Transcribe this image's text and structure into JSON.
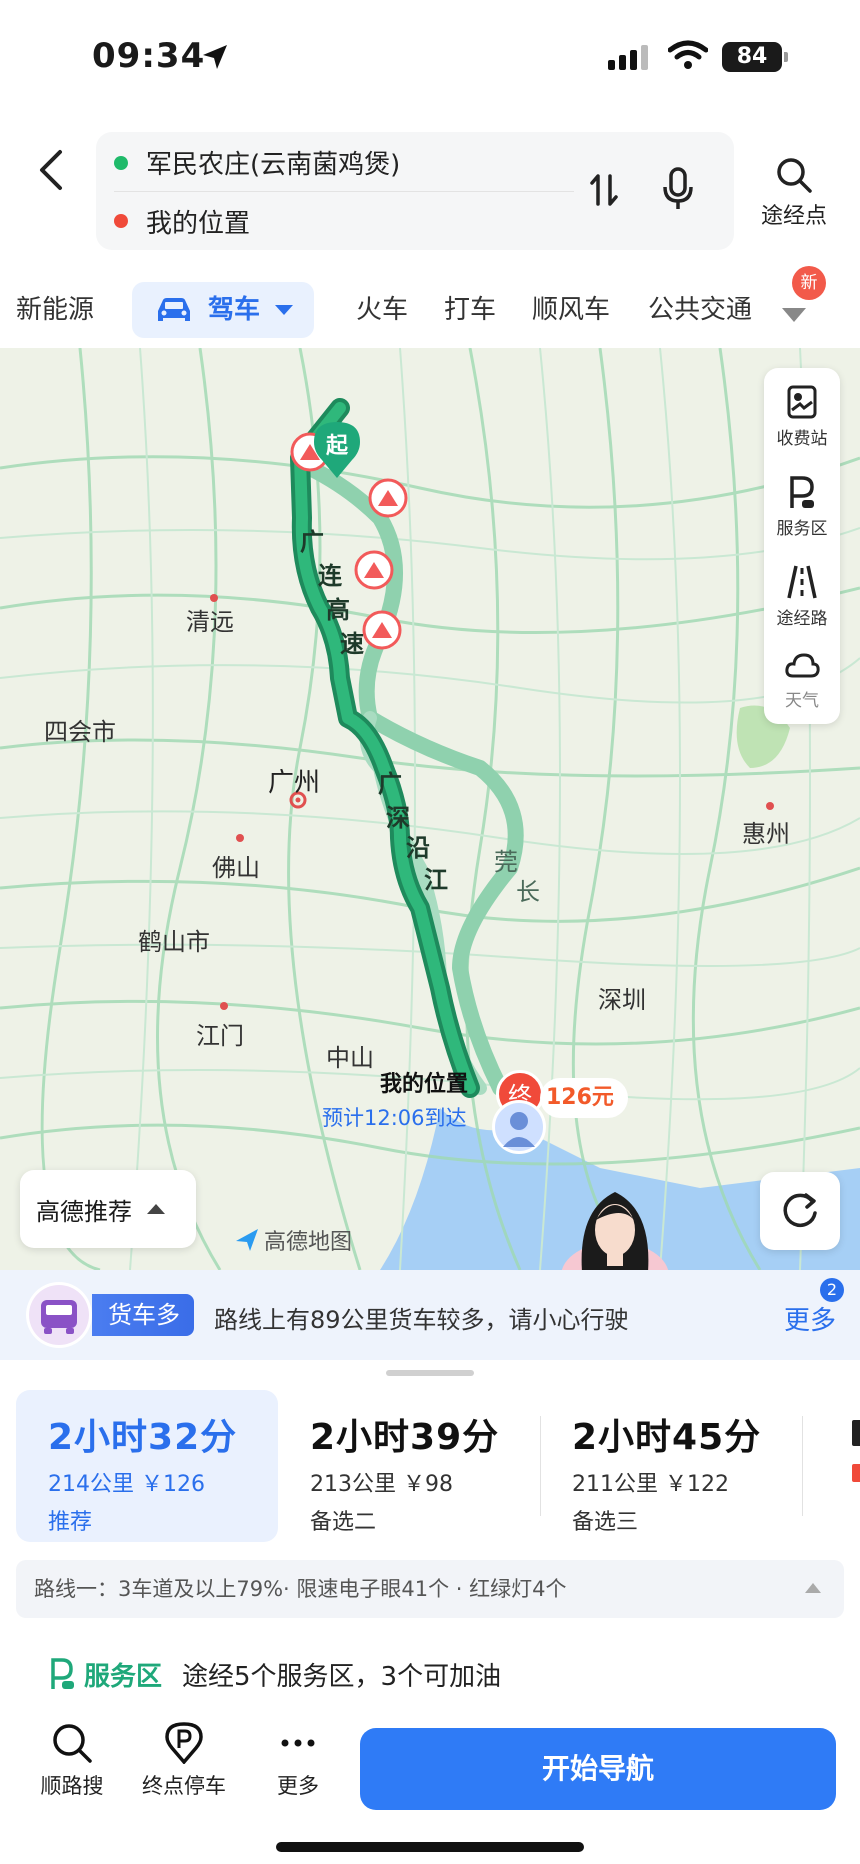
{
  "status_bar": {
    "time": "09:34",
    "battery": "84"
  },
  "search": {
    "origin": "军民农庄(云南菌鸡煲)",
    "destination": "我的位置",
    "waypoint_label": "途经点"
  },
  "tabs": [
    {
      "label": "新能源"
    },
    {
      "label": "驾车"
    },
    {
      "label": "火车"
    },
    {
      "label": "打车"
    },
    {
      "label": "顺风车"
    },
    {
      "label": "公共交通"
    }
  ],
  "new_badge": "新",
  "map": {
    "start_marker": "起",
    "end_marker": "终",
    "my_position": "我的位置",
    "eta": "预计12:06到达",
    "toll": "126元",
    "cities": [
      "清远",
      "四会市",
      "广州",
      "佛山",
      "鹤山市",
      "惠州",
      "深圳",
      "江门",
      "中山"
    ],
    "roads": [
      "广",
      "连",
      "高",
      "速",
      "广",
      "深",
      "沿",
      "江",
      "莞",
      "长"
    ],
    "logo": "高德地图",
    "recommend_label": "高德推荐",
    "side_panel": [
      {
        "label": "收费站",
        "icon": "toll-icon"
      },
      {
        "label": "服务区",
        "icon": "service-area-icon"
      },
      {
        "label": "途经路",
        "icon": "road-icon"
      },
      {
        "label": "天气",
        "icon": "cloud-icon"
      }
    ]
  },
  "truck_banner": {
    "tag": "货车多",
    "text": "路线上有89公里货车较多，请小心行驶",
    "more_label": "更多",
    "more_count": "2"
  },
  "routes": [
    {
      "time": "2小时32分",
      "meta": "214公里 ￥126",
      "tag": "推荐"
    },
    {
      "time": "2小时39分",
      "meta": "213公里 ￥98",
      "tag": "备选二"
    },
    {
      "time": "2小时45分",
      "meta": "211公里 ￥122",
      "tag": "备选三"
    }
  ],
  "summary": "路线一：3车道及以上79%· 限速电子眼41个 · 红绿灯4个",
  "service": {
    "tag": "服务区",
    "text": "途经5个服务区，3个可加油"
  },
  "bottom_bar": {
    "items": [
      {
        "label": "顺路搜"
      },
      {
        "label": "终点停车"
      },
      {
        "label": "更多"
      }
    ],
    "nav_button": "开始导航"
  },
  "colors": {
    "accent": "#2f7bf6",
    "route_main": "#1f9e6a",
    "route_alt": "#8fd1ae",
    "warning": "#f04a3a"
  }
}
